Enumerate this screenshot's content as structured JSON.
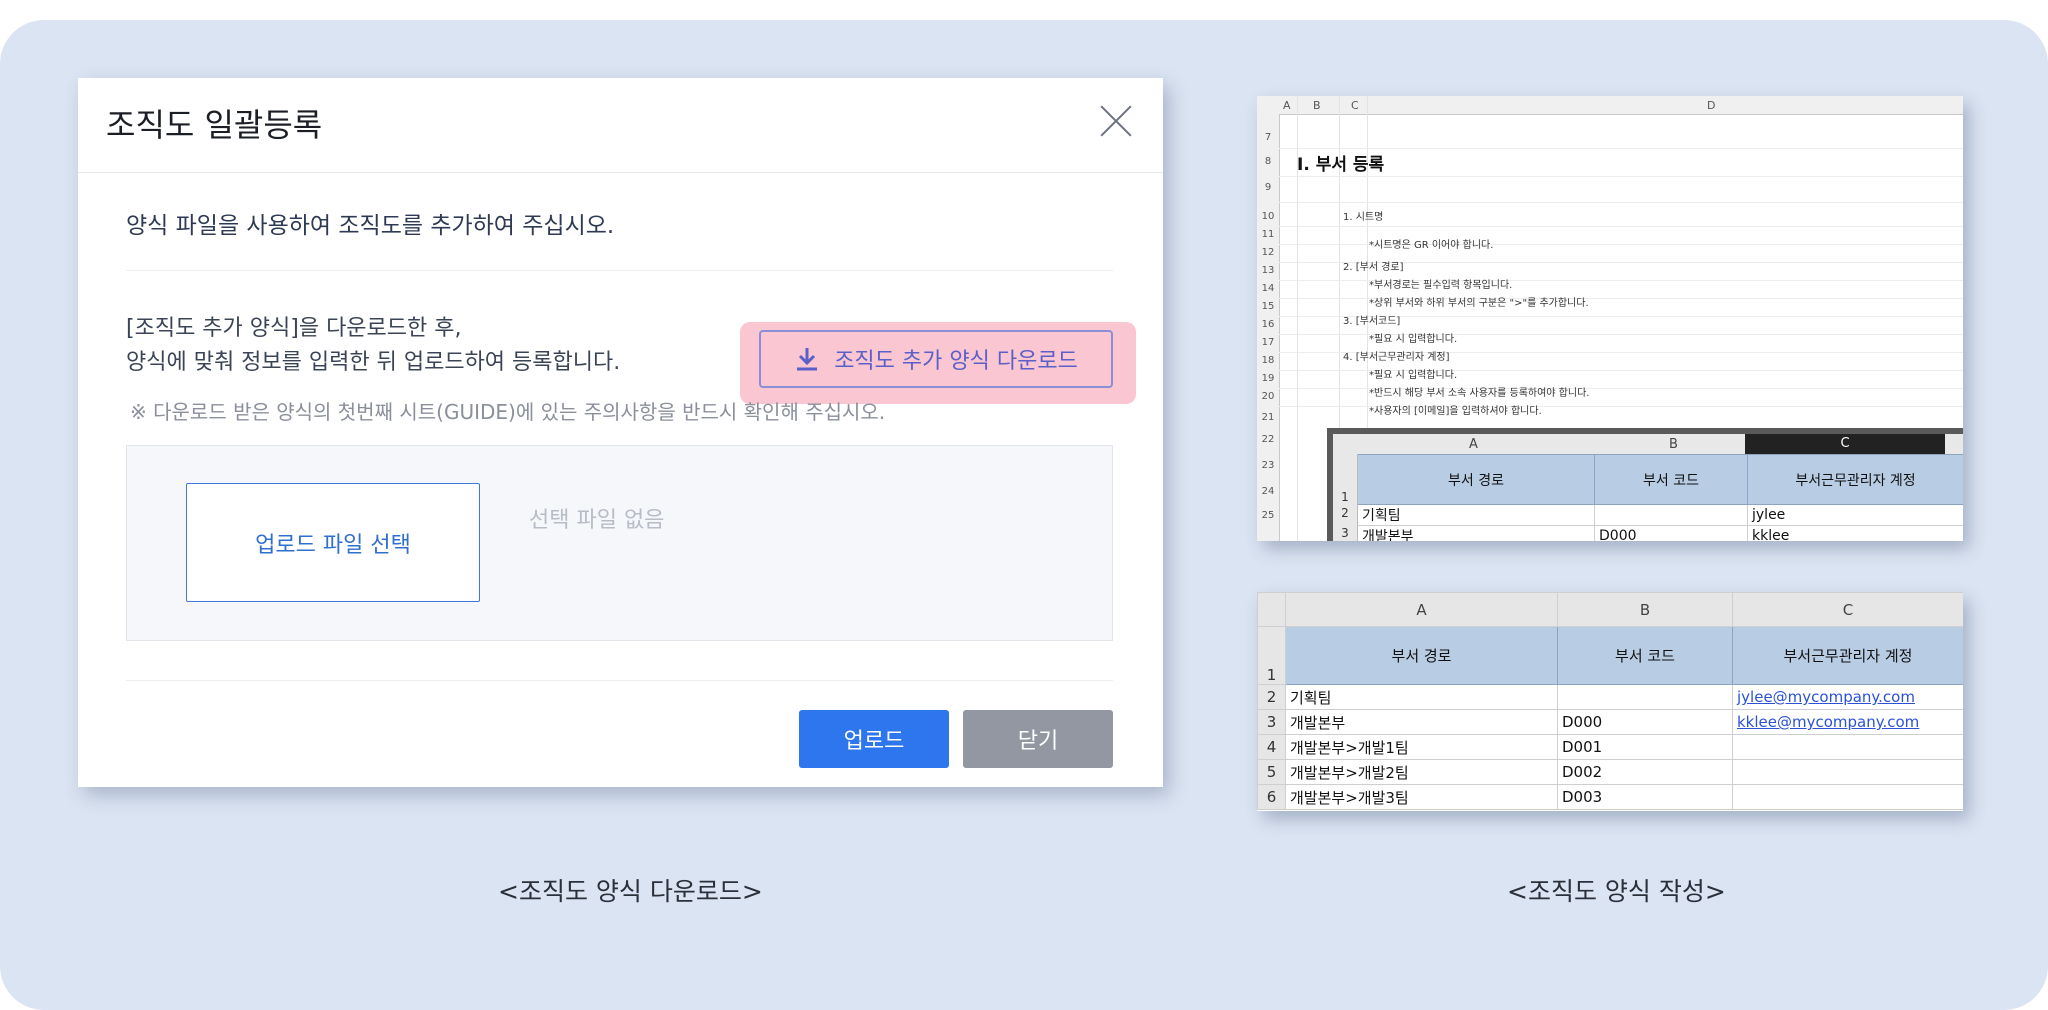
{
  "modal": {
    "title": "조직도 일괄등록",
    "lead": "양식 파일을 사용하여 조직도를 추가하여 주십시오.",
    "desc_line1": "[조직도 추가 양식]을 다운로드한 후,",
    "desc_line2": "양식에 맞춰 정보를 입력한 뒤 업로드하여 등록합니다.",
    "download_button": "조직도 추가 양식 다운로드",
    "notice": "※ 다운로드 받은 양식의 첫번째 시트(GUIDE)에 있는 주의사항을 반드시 확인해 주십시오.",
    "file_select_button": "업로드 파일 선택",
    "no_file_text": "선택 파일 없음",
    "upload_button": "업로드",
    "close_button": "닫기"
  },
  "captions": {
    "left": "<조직도 양식 다운로드>",
    "right": "<조직도 양식 작성>"
  },
  "guide_sheet": {
    "columns": [
      "A",
      "B",
      "C",
      "D"
    ],
    "rows": [
      "7",
      "8",
      "9",
      "10",
      "11",
      "12",
      "13",
      "14",
      "15",
      "16",
      "17",
      "18",
      "19",
      "20",
      "21",
      "22",
      "23",
      "24",
      "25"
    ],
    "heading": "I. 부서 등록",
    "lines": [
      "1. 시트명",
      "*시트명은 GR 이어야 합니다.",
      "2. [부서 경로]",
      "*부서경로는 필수입력 항목입니다.",
      "*상위 부서와 하위 부서의 구분은 \">\"를 추가합니다.",
      "3. [부서코드]",
      "*필요 시 입력합니다.",
      "4. [부서근무관리자 계정]",
      "*필요 시 입력합니다.",
      "*반드시 해당 부서 소속 사용자를 등록하여야 합니다.",
      "*사용자의 [이메일]을 입력하셔야 합니다."
    ],
    "inset": {
      "columns": [
        "A",
        "B",
        "C"
      ],
      "header": [
        "부서 경로",
        "부서 코드",
        "부서근무관리자 계정"
      ],
      "rows": [
        {
          "num": "1"
        },
        {
          "num": "2",
          "path": "기획팀",
          "code": "",
          "account": "jylee"
        },
        {
          "num": "3",
          "path": "개발본부",
          "code": "D000",
          "account": "kklee"
        }
      ]
    }
  },
  "form_sheet": {
    "columns": [
      "A",
      "B",
      "C"
    ],
    "header": [
      "부서 경로",
      "부서 코드",
      "부서근무관리자 계정"
    ],
    "rows": [
      {
        "num": "2",
        "path": "기획팀",
        "code": "",
        "account": "jylee@mycompany.com"
      },
      {
        "num": "3",
        "path": "개발본부",
        "code": "D000",
        "account": "kklee@mycompany.com"
      },
      {
        "num": "4",
        "path": "개발본부>개발1팀",
        "code": "D001",
        "account": ""
      },
      {
        "num": "5",
        "path": "개발본부>개발2팀",
        "code": "D002",
        "account": ""
      },
      {
        "num": "6",
        "path": "개발본부>개발3팀",
        "code": "D003",
        "account": ""
      }
    ]
  }
}
